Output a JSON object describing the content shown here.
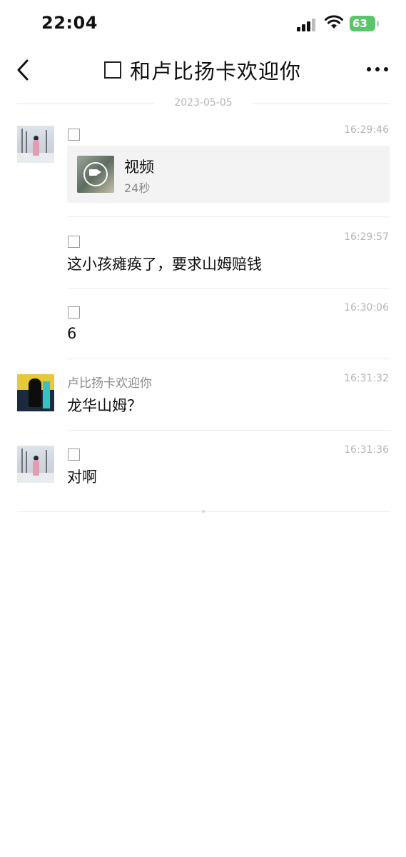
{
  "status_bar": {
    "time": "22:04",
    "battery": "63"
  },
  "nav": {
    "title": "和卢比扬卡欢迎你",
    "back_icon": "chevron-left-icon",
    "more_icon": "more-dots-icon"
  },
  "date_divider": "2023-05-05",
  "messages": [
    {
      "sender": "",
      "time": "16:29:46",
      "type": "video",
      "video_label": "视频",
      "video_duration": "24秒"
    },
    {
      "sender": "",
      "time": "16:29:57",
      "type": "text",
      "text": "这小孩瘫痪了，要求山姆赔钱"
    },
    {
      "sender": "",
      "time": "16:30:06",
      "type": "text",
      "text": "6"
    },
    {
      "sender": "卢比扬卡欢迎你",
      "time": "16:31:32",
      "type": "text",
      "text": "龙华山姆？"
    },
    {
      "sender": "",
      "time": "16:31:36",
      "type": "text",
      "text": "对啊"
    }
  ]
}
